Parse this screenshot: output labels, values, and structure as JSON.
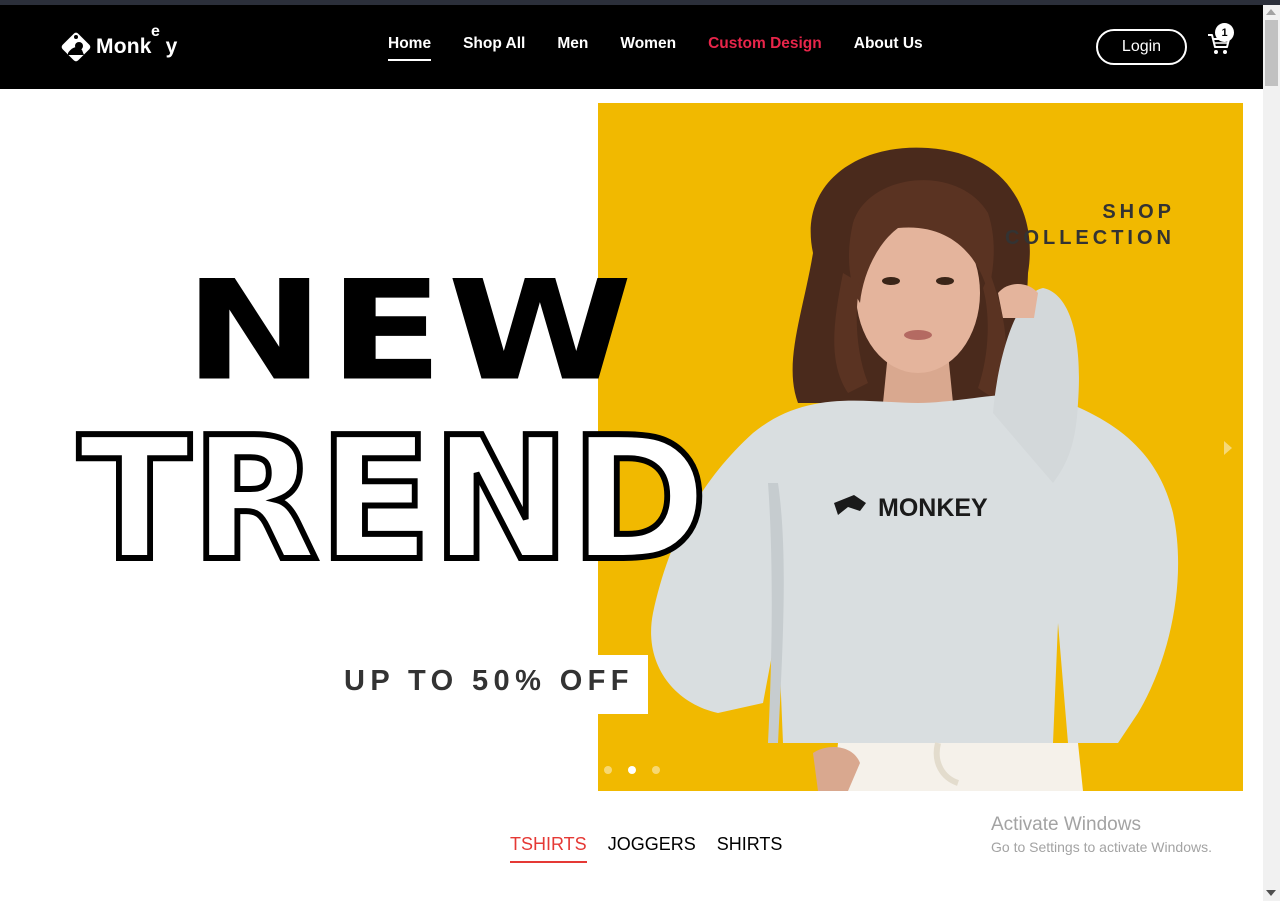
{
  "brand": {
    "name": "Monk",
    "e": "e",
    "tail": "y"
  },
  "nav": {
    "links": [
      "Home",
      "Shop All",
      "Men",
      "Women",
      "Custom Design",
      "About Us"
    ],
    "login": "Login",
    "cart_count": "1"
  },
  "hero": {
    "headline_1": "NEW",
    "headline_2": "TREND",
    "offer": "UP TO 50% OFF",
    "shop_1": "SHOP",
    "shop_2": "COLLECTION",
    "shirt_brand": "MONKEY",
    "bg_color": "#f1b900"
  },
  "categories": [
    "TSHIRTS",
    "JOGGERS",
    "SHIRTS"
  ],
  "watermark": {
    "title": "Activate Windows",
    "subtitle": "Go to Settings to activate Windows."
  },
  "colors": {
    "accent": "#e8254a",
    "tab_active": "#e53935"
  }
}
